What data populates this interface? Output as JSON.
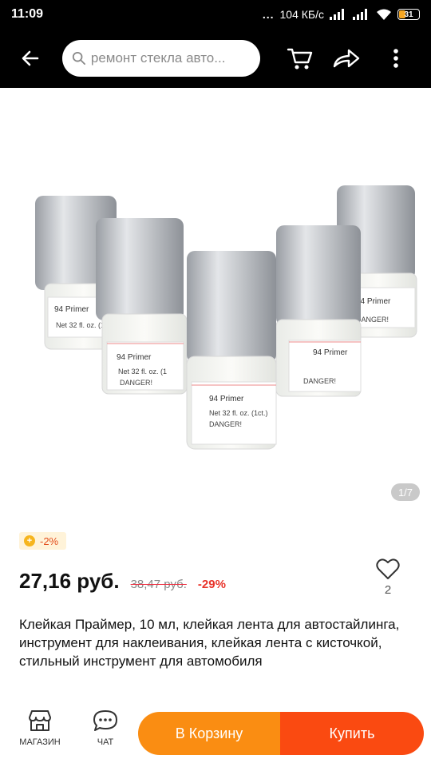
{
  "status": {
    "time": "11:09",
    "network_dots": "...",
    "speed": "104 КБ/с",
    "battery": "31"
  },
  "search": {
    "placeholder": "ремонт стекла авто..."
  },
  "gallery": {
    "counter": "1/7",
    "bottle_label_name": "94 Primer",
    "bottle_label_net": "Net 32 fl. oz. (1ct.)",
    "bottle_label_danger": "DANGER!"
  },
  "promo": {
    "coin_discount": "-2%"
  },
  "price": {
    "current": "27,16 руб.",
    "original": "38,47 руб.",
    "discount": "-29%"
  },
  "wishlist": {
    "count": "2"
  },
  "product": {
    "title": "Клейкая Праймер, 10 мл, клейкая лента для автостайлинга, инструмент для наклеивания, клейкая лента с кисточкой, стильный инструмент для автомобиля"
  },
  "bottom_bar": {
    "shop_label": "МАГАЗИН",
    "chat_label": "ЧАТ",
    "add_to_cart": "В Корзину",
    "buy": "Купить"
  },
  "colors": {
    "cart_button": "#fa8d12",
    "buy_button": "#fa4a11",
    "discount_text": "#e8332a"
  }
}
